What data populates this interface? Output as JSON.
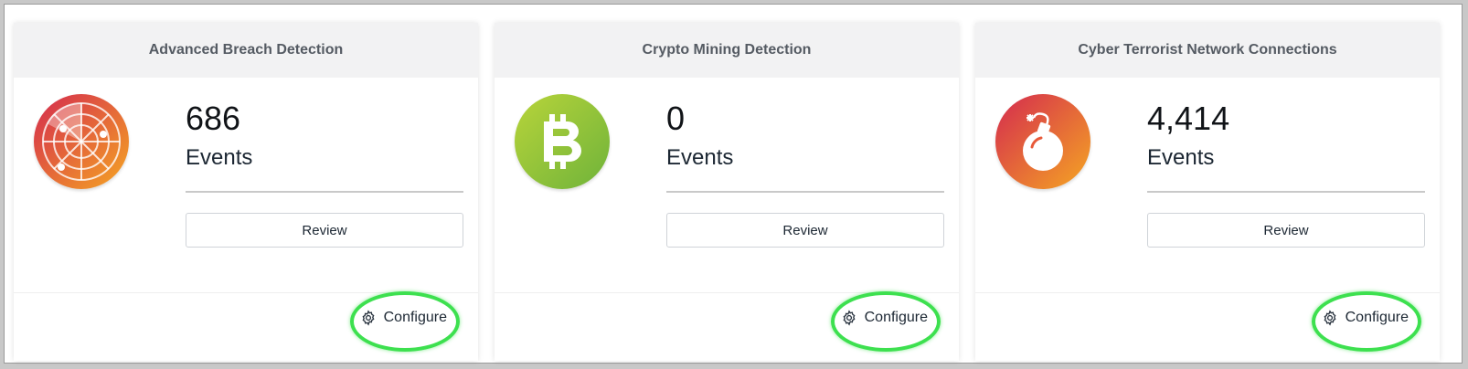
{
  "colors": {
    "header_bg": "#f2f2f3",
    "highlight": "#3de04f",
    "breach_gradient": [
      "#d42a4f",
      "#f5a623"
    ],
    "crypto_gradient": [
      "#b8d43a",
      "#6fb33a"
    ],
    "terror_gradient": [
      "#d42a4f",
      "#f5a623"
    ]
  },
  "cards": [
    {
      "title": "Advanced Breach Detection",
      "icon": "radar-icon",
      "count": "686",
      "unit": "Events",
      "review_label": "Review",
      "configure_label": "Configure",
      "configure_icon": "gear-icon"
    },
    {
      "title": "Crypto Mining Detection",
      "icon": "bitcoin-icon",
      "count": "0",
      "unit": "Events",
      "review_label": "Review",
      "configure_label": "Configure",
      "configure_icon": "gear-icon"
    },
    {
      "title": "Cyber Terrorist Network Connections",
      "icon": "bomb-icon",
      "count": "4,414",
      "unit": "Events",
      "review_label": "Review",
      "configure_label": "Configure",
      "configure_icon": "gear-icon"
    }
  ]
}
